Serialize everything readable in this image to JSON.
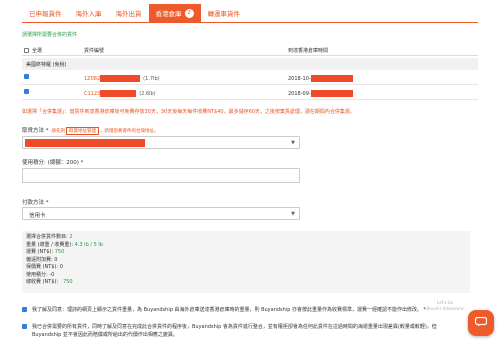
{
  "tabs": [
    {
      "label": "已申報貨件"
    },
    {
      "label": "海外入庫"
    },
    {
      "label": "海外出貨"
    },
    {
      "label": "香港倉庫",
      "badge": "2",
      "active": true
    },
    {
      "label": "轉運車貨件"
    }
  ],
  "section_title": "請選擇所需要合併的貨件",
  "table": {
    "select_all": "全選",
    "col_tracking": "貨件編號",
    "col_arrival": "到達香港倉庫時間",
    "group_label": "美國終特羅 (免稅)",
    "rows": [
      {
        "tracking_prefix": "1Z082",
        "weight": "(1.7lb)",
        "arrival_prefix": "2018-10-",
        "checked": true
      },
      {
        "tracking_prefix": "C1123",
        "weight": "(2.6lb)",
        "arrival_prefix": "2018-09-",
        "checked": true
      }
    ]
  },
  "notice": "如選擇「合併集運」：當貨件到達香港倉庫後可免費存放30天，30天後每天每件收費NT$40，最多儲存60天，之後按棄貨處理，請在期間內合併集運。",
  "pickup": {
    "label": "取貨方法 *",
    "hint_before": "請先到",
    "hint_link": "取貨地址管理",
    "hint_after": "，新增您要寄件的台灣地址。"
  },
  "points": {
    "label": "使用積分: (總額：200) *",
    "value": ""
  },
  "payment": {
    "label": "付款方法 *",
    "selected": "信用卡"
  },
  "summary": {
    "count_label": "選擇合併貨件數目:",
    "count_value": "2",
    "weight_label": "重量 (總重 / 收費重):",
    "weight_value": "4.3 lb / 5 lb",
    "shipping_label": "運費 (NT$):",
    "shipping_value": "750",
    "surcharge_label": "偏遠附加費:",
    "surcharge_value": "0",
    "insurance_label": "保價費 (NT$):",
    "insurance_value": "0",
    "points_label": "使用積分:",
    "points_value": "-0",
    "total_label": "總收費 (NT$)：",
    "total_value": "750"
  },
  "agreements": [
    "我了解及同意：理詩的網頁上顯示之貨件重量，為 Buyandship 由海外倉庫送達香港倉庫時的重量，則 Buyandship 亦會按此重量作為收費標準，運費一經確認不能作出修改。 *",
    "我已合併需要的所有貨件，同時了解及同意在完成此合併貨件的程序後，Buyandship 會為貨件進行整合，並有權拒卻會為任何此貨件在這過時間的海運重量出現差異(較量或較輕)，但 Buyandship 並不會因此而賠償或所給出的代價作出相應之變異。"
  ],
  "watermark": [
    "Let's Go",
    "Bruce's Adventure"
  ],
  "colors": {
    "accent": "#ef5a2a",
    "green": "#2a9a46",
    "check": "#2f7de1",
    "redact": "#ef4a2a"
  },
  "icons": {
    "chat": "chat-bubble-icon",
    "caret": "chevron-down-icon"
  }
}
